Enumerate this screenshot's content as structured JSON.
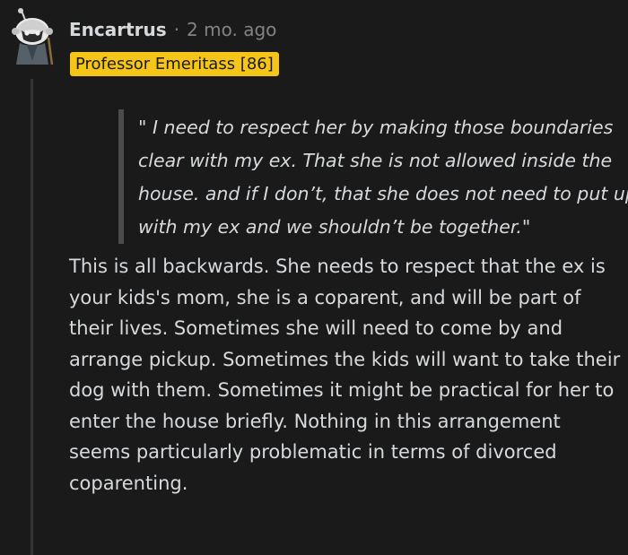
{
  "comment": {
    "username": "Encartrus",
    "separator": "·",
    "time": "2 mo. ago",
    "flair": "Professor Emeritass [86]",
    "quote": "\" I need to respect her by making those boundaries clear with my ex. That she is not allowed inside the house. and if I don’t, that she does not need to put up with my ex and we shouldn’t be together.\"",
    "body": "This is all backwards. She needs to respect that the ex is your kids's mom, she is a coparent, and will be part of their lives. Sometimes she will need to come by and arrange pickup. Sometimes the kids will want to take their dog with them. Sometimes it might be practical for her to enter the house briefly. Nothing in this arrangement seems particularly problematic in terms of divorced coparenting."
  },
  "colors": {
    "background": "#1a1a1b",
    "text": "#d7dadc",
    "meta": "#818384",
    "flair_bg": "#f5c518",
    "quote_bar": "#4a4b4c",
    "thread_line": "#343536"
  },
  "icons": {
    "avatar": "snoo-avatar-icon"
  }
}
